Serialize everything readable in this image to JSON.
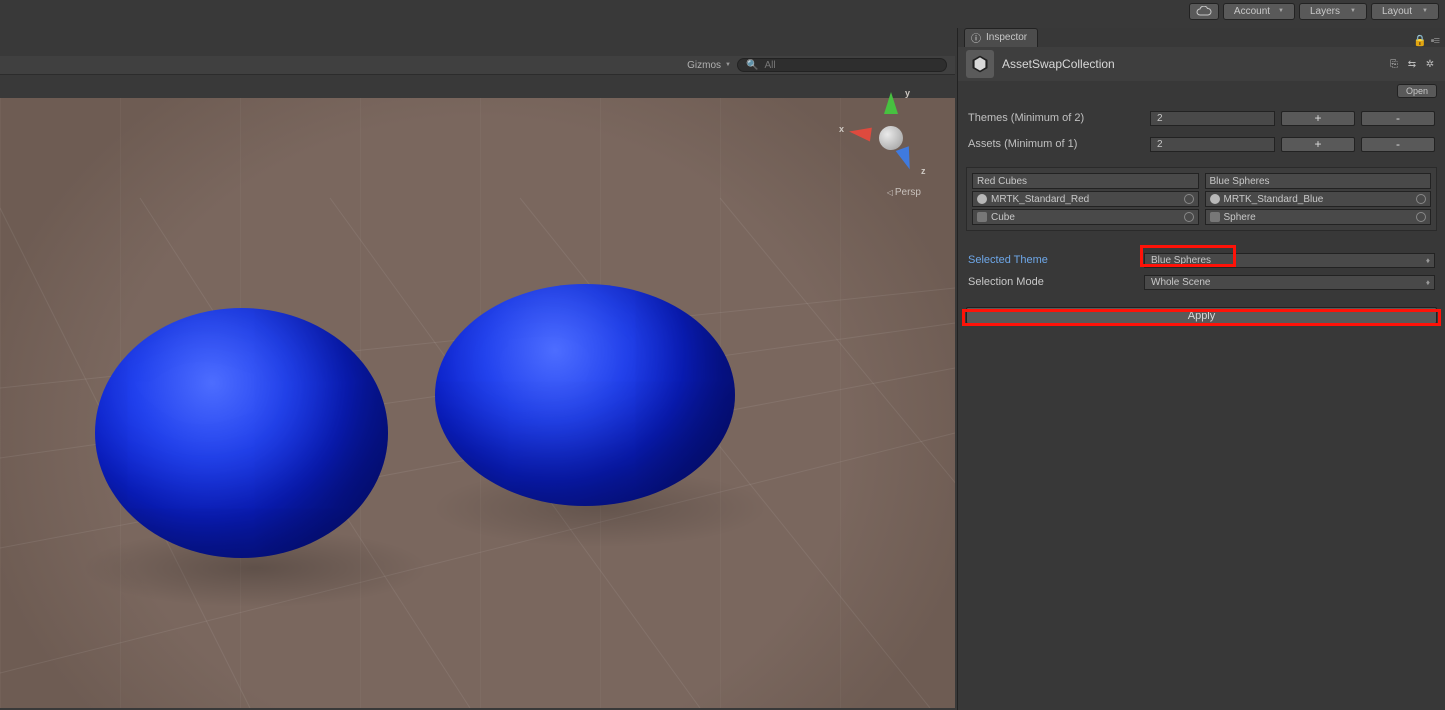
{
  "topbar": {
    "account": "Account",
    "layers": "Layers",
    "layout": "Layout"
  },
  "scene": {
    "gizmos": "Gizmos",
    "search_placeholder": "All",
    "persp": "Persp",
    "axes": {
      "x": "x",
      "y": "y",
      "z": "z"
    }
  },
  "inspector": {
    "tab": "Inspector",
    "title": "AssetSwapCollection",
    "open": "Open",
    "rows": {
      "themes_label": "Themes (Minimum of 2)",
      "themes_value": "2",
      "assets_label": "Assets (Minimum of 1)",
      "assets_value": "2",
      "plus": "+",
      "minus": "-"
    },
    "themes": [
      {
        "name": "Red Cubes",
        "material": "MRTK_Standard_Red",
        "mesh": "Cube"
      },
      {
        "name": "Blue Spheres",
        "material": "MRTK_Standard_Blue",
        "mesh": "Sphere"
      }
    ],
    "selected_theme_label": "Selected Theme",
    "selected_theme_value": "Blue Spheres",
    "selection_mode_label": "Selection Mode",
    "selection_mode_value": "Whole Scene",
    "apply": "Apply"
  }
}
